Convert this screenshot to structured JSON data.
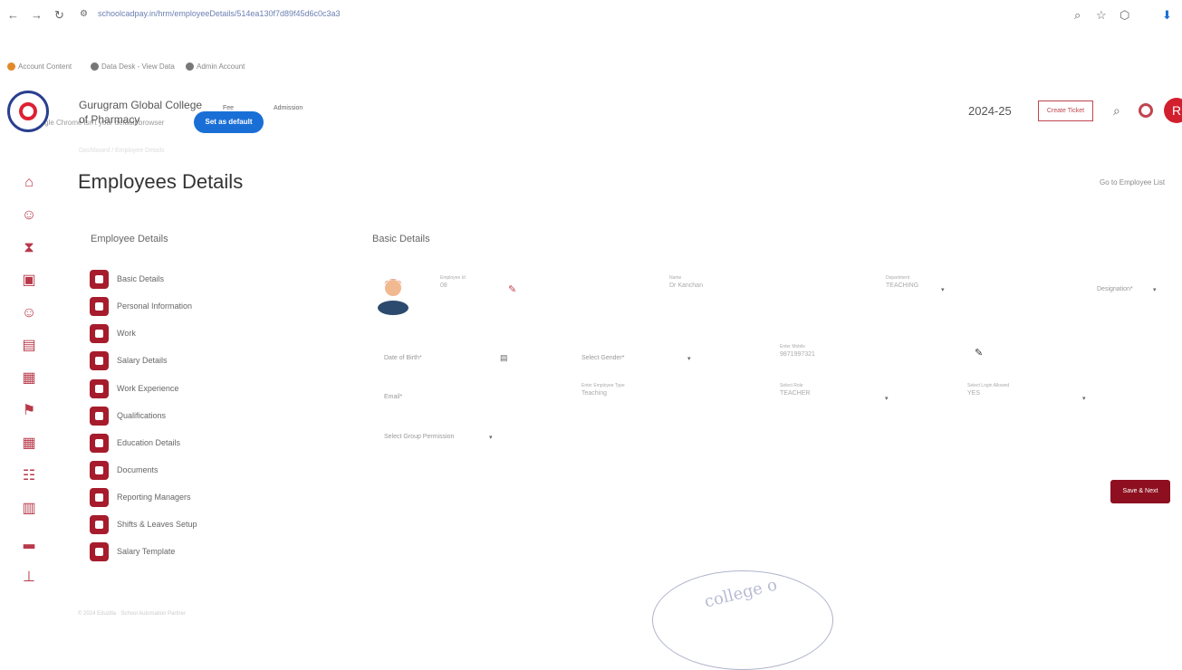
{
  "browser": {
    "url": "schoolcadpay.in/hrm/employeeDetails/514ea130f7d89f45d6c0c3a3",
    "bookmarks": [
      "Account Content",
      "Data Desk - View Data",
      "Admin Account"
    ],
    "infobar_text": "Google Chrome isn't your default browser",
    "set_default_label": "Set as default"
  },
  "header": {
    "college_name": "Gurugram Global College of Pharmacy",
    "nav": [
      "Fee",
      "Admission"
    ],
    "session": "2024-25",
    "create_ticket_label": "Create Ticket",
    "avatar_letter": "R",
    "breadcrumb": "Dashboard / Employee Details"
  },
  "page": {
    "title": "Employees Details",
    "goto_list_label": "Go to Employee List",
    "left_heading": "Employee Details",
    "right_heading": "Basic Details"
  },
  "menu": [
    {
      "label": "Basic Details",
      "icon": "info-icon"
    },
    {
      "label": "Personal Information",
      "icon": "person-icon"
    },
    {
      "label": "Work",
      "icon": "briefcase-icon"
    },
    {
      "label": "Salary Details",
      "icon": "money-icon"
    },
    {
      "label": "Work Experience",
      "icon": "doc-icon"
    },
    {
      "label": "Qualifications",
      "icon": "doc-icon"
    },
    {
      "label": "Education Details",
      "icon": "doc-icon"
    },
    {
      "label": "Documents",
      "icon": "file-icon"
    },
    {
      "label": "Reporting Managers",
      "icon": "users-icon"
    },
    {
      "label": "Shifts & Leaves Setup",
      "icon": "grid-icon"
    },
    {
      "label": "Salary Template",
      "icon": "grid-icon"
    }
  ],
  "form": {
    "employee_id_label": "Employee Id",
    "employee_id_value": "08",
    "name_label": "Name",
    "name_value": "Dr Kanchan",
    "department_label": "Department",
    "department_value": "TEACHING",
    "designation_placeholder": "Designation*",
    "dob_placeholder": "Date of Birth*",
    "gender_placeholder": "Select Gender*",
    "mobile_label": "Enter Mobile",
    "mobile_value": "9871997321",
    "email_placeholder": "Email*",
    "emp_type_label": "Enter Employee Type",
    "emp_type_value": "Teaching",
    "role_label": "Select Role",
    "role_value": "TEACHER",
    "login_allowed_label": "Select Login Allowed",
    "login_allowed_value": "YES",
    "group_permission_placeholder": "Select Group Permission"
  },
  "save_next_label": "Save & Next",
  "footer": "© 2024 Eduzilla · School Automation Partner",
  "colors": {
    "accent": "#a61c2c",
    "primary_button": "#8e1020",
    "browser_button": "#1a6fd6"
  }
}
